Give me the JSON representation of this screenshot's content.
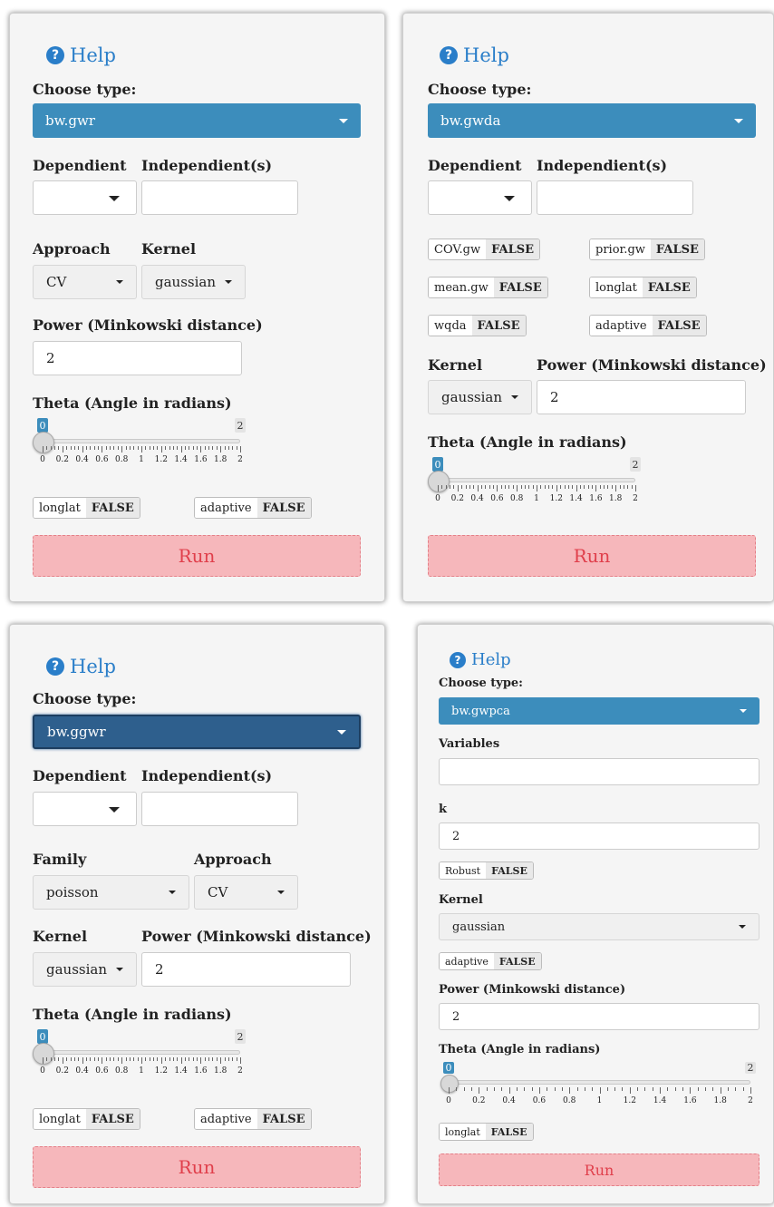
{
  "colors": {
    "accent": "#3c8dbc",
    "help": "#2a7ec9",
    "run_bg": "#f6b7bb",
    "run_text": "#e0404c"
  },
  "panels": {
    "gwr": {
      "help_label": "Help",
      "choose_type_label": "Choose type:",
      "type_value": "bw.gwr",
      "dependent_label": "Dependient",
      "independent_label": "Independient(s)",
      "dependent_value": "",
      "independent_value": "",
      "approach_label": "Approach",
      "approach_value": "CV",
      "kernel_label": "Kernel",
      "kernel_value": "gaussian",
      "power_label": "Power (Minkowski distance)",
      "power_value": "2",
      "theta_label": "Theta (Angle in radians)",
      "slider_value": "0",
      "slider_max": "2",
      "ticks": [
        "0",
        "0.2",
        "0.4",
        "0.6",
        "0.8",
        "1",
        "1.2",
        "1.4",
        "1.6",
        "1.8",
        "2"
      ],
      "toggles": [
        {
          "name": "longlat",
          "value": "FALSE"
        },
        {
          "name": "adaptive",
          "value": "FALSE"
        }
      ],
      "run_label": "Run"
    },
    "gwda": {
      "help_label": "Help",
      "choose_type_label": "Choose type:",
      "type_value": "bw.gwda",
      "dependent_label": "Dependient",
      "independent_label": "Independient(s)",
      "toggles": [
        {
          "name": "COV.gw",
          "value": "FALSE"
        },
        {
          "name": "prior.gw",
          "value": "FALSE"
        },
        {
          "name": "mean.gw",
          "value": "FALSE"
        },
        {
          "name": "longlat",
          "value": "FALSE"
        },
        {
          "name": "wqda",
          "value": "FALSE"
        },
        {
          "name": "adaptive",
          "value": "FALSE"
        }
      ],
      "kernel_label": "Kernel",
      "kernel_value": "gaussian",
      "power_label": "Power (Minkowski distance)",
      "power_value": "2",
      "theta_label": "Theta (Angle in radians)",
      "slider_value": "0",
      "slider_max": "2",
      "ticks": [
        "0",
        "0.2",
        "0.4",
        "0.6",
        "0.8",
        "1",
        "1.2",
        "1.4",
        "1.6",
        "1.8",
        "2"
      ],
      "run_label": "Run"
    },
    "ggwr": {
      "help_label": "Help",
      "choose_type_label": "Choose type:",
      "type_value": "bw.ggwr",
      "dependent_label": "Dependient",
      "independent_label": "Independient(s)",
      "family_label": "Family",
      "family_value": "poisson",
      "approach_label": "Approach",
      "approach_value": "CV",
      "kernel_label": "Kernel",
      "kernel_value": "gaussian",
      "power_label": "Power (Minkowski distance)",
      "power_value": "2",
      "theta_label": "Theta (Angle in radians)",
      "slider_value": "0",
      "slider_max": "2",
      "ticks": [
        "0",
        "0.2",
        "0.4",
        "0.6",
        "0.8",
        "1",
        "1.2",
        "1.4",
        "1.6",
        "1.8",
        "2"
      ],
      "toggles": [
        {
          "name": "longlat",
          "value": "FALSE"
        },
        {
          "name": "adaptive",
          "value": "FALSE"
        }
      ],
      "run_label": "Run"
    },
    "gwpca": {
      "help_label": "Help",
      "choose_type_label": "Choose type:",
      "type_value": "bw.gwpca",
      "variables_label": "Variables",
      "variables_value": "",
      "k_label": "k",
      "k_value": "2",
      "robust_toggle": {
        "name": "Robust",
        "value": "FALSE"
      },
      "kernel_label": "Kernel",
      "kernel_value": "gaussian",
      "adaptive_toggle": {
        "name": "adaptive",
        "value": "FALSE"
      },
      "power_label": "Power (Minkowski distance)",
      "power_value": "2",
      "theta_label": "Theta (Angle in radians)",
      "slider_value": "0",
      "slider_max": "2",
      "ticks": [
        "0",
        "0.2",
        "0.4",
        "0.6",
        "0.8",
        "1",
        "1.2",
        "1.4",
        "1.6",
        "1.8",
        "2"
      ],
      "longlat_toggle": {
        "name": "longlat",
        "value": "FALSE"
      },
      "run_label": "Run"
    }
  }
}
